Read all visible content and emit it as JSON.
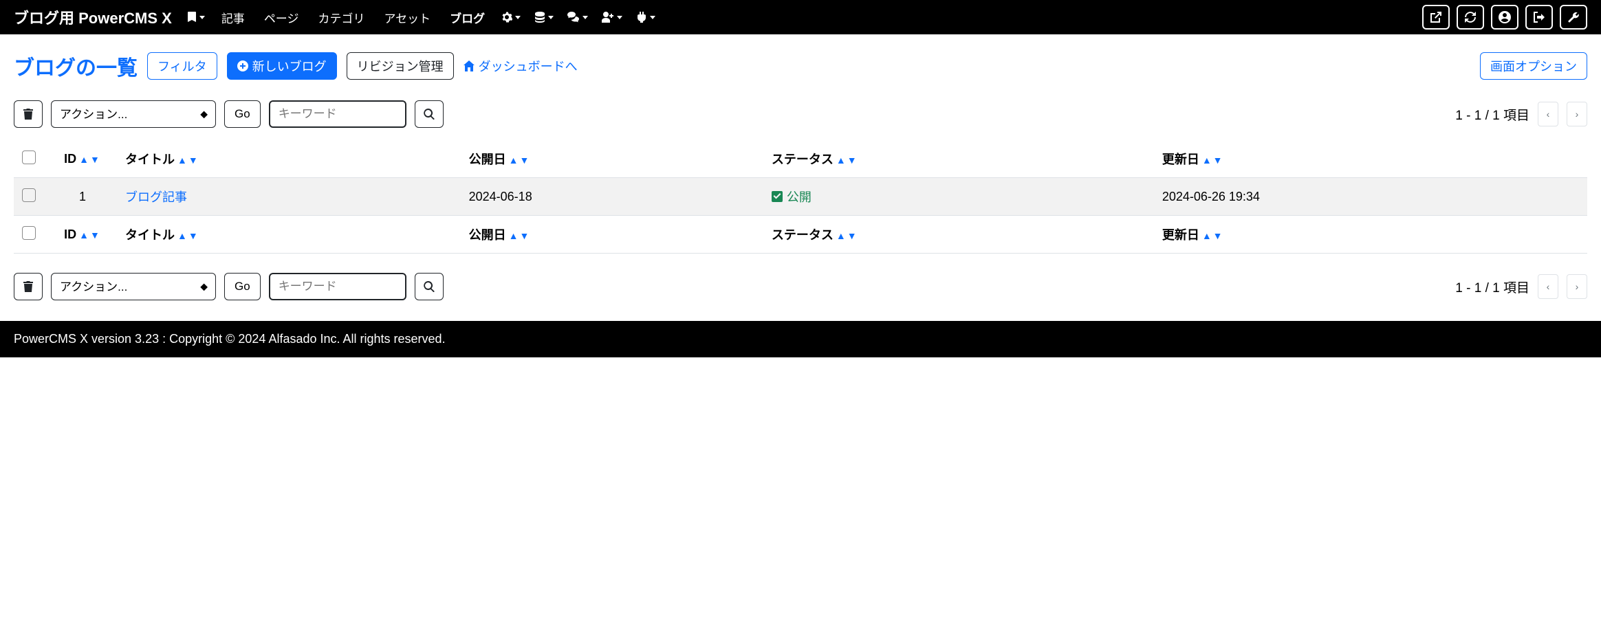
{
  "navbar": {
    "brand": "ブログ用 PowerCMS X",
    "items": [
      {
        "label": "記事"
      },
      {
        "label": "ページ"
      },
      {
        "label": "カテゴリ"
      },
      {
        "label": "アセット"
      },
      {
        "label": "ブログ",
        "active": true
      }
    ]
  },
  "page": {
    "title": "ブログの一覧",
    "filter_btn": "フィルタ",
    "new_btn": "新しいブログ",
    "revision_btn": "リビジョン管理",
    "dashboard_link": "ダッシュボードへ",
    "screen_options": "画面オプション"
  },
  "toolbar": {
    "action_placeholder": "アクション...",
    "go_btn": "Go",
    "search_placeholder": "キーワード",
    "pagination": "1 - 1 / 1 項目"
  },
  "table": {
    "headers": {
      "id": "ID",
      "title": "タイトル",
      "published": "公開日",
      "status": "ステータス",
      "updated": "更新日"
    },
    "rows": [
      {
        "id": "1",
        "title": "ブログ記事",
        "published": "2024-06-18",
        "status": "公開",
        "updated": "2024-06-26 19:34"
      }
    ]
  },
  "footer": {
    "text": "PowerCMS X version 3.23 : Copyright © 2024 Alfasado Inc. All rights reserved."
  }
}
